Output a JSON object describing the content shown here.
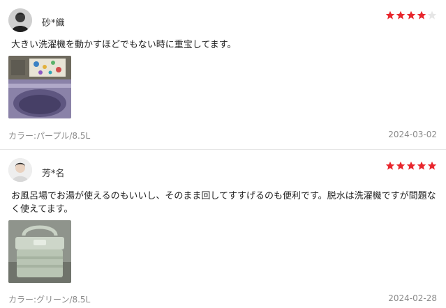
{
  "colors": {
    "star_filled": "#e8262d",
    "star_empty": "#e6e6e6",
    "meta_text": "#8a8a8a",
    "divider": "#e6e6e6"
  },
  "reviews": [
    {
      "avatar_icon": "user-avatar-dark-icon",
      "username": "砂*織",
      "rating": 4,
      "max_rating": 5,
      "comment": "大きい洗濯機を動かすほどでもない時に重宝してます。",
      "photo_icon": "purple-washer-photo",
      "variant": "カラー:パープル/8.5L",
      "date": "2024-03-02"
    },
    {
      "avatar_icon": "user-avatar-light-icon",
      "username": "芳*名",
      "rating": 5,
      "max_rating": 5,
      "comment": "お風呂場でお湯が使えるのもいいし、そのまま回してすすげるのも便利です。脱水は洗濯機ですが問題なく使えてます。",
      "photo_icon": "green-washer-photo",
      "variant": "カラー:グリーン/8.5L",
      "date": "2024-02-28"
    }
  ]
}
